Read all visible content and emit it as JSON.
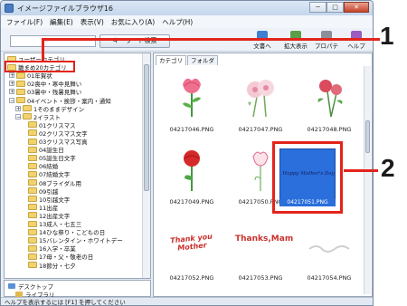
{
  "window": {
    "title": "イメージファイルブラウザ16",
    "buttons": {
      "minimize": "─",
      "maximize": "□",
      "close": "✕"
    }
  },
  "menu": [
    "ファイル(F)",
    "編集(E)",
    "表示(V)",
    "お気に入り(A)",
    "ヘルプ(H)"
  ],
  "toolbar": {
    "search_value": "",
    "search_button": "キーワード検索",
    "tools": [
      {
        "label": "文書へ",
        "icon": "document-icon"
      },
      {
        "label": "拡大表示",
        "icon": "zoom-icon"
      },
      {
        "label": "プロパティ",
        "icon": "properties-icon"
      },
      {
        "label": "ヘルプ",
        "icon": "help-icon"
      }
    ]
  },
  "tree": {
    "items": [
      {
        "label": "ユーザーカテゴリ",
        "depth": 0,
        "expander": ""
      },
      {
        "label": "雛まめ20カテゴリ",
        "depth": 0,
        "expander": ""
      },
      {
        "label": "01年賀状",
        "depth": 1,
        "expander": "+"
      },
      {
        "label": "02喪中・寒中見舞い",
        "depth": 1,
        "expander": "+"
      },
      {
        "label": "03暑中・残暑見舞い",
        "depth": 1,
        "expander": "+"
      },
      {
        "label": "04イベント・挨拶・案内・通知",
        "depth": 1,
        "expander": "−"
      },
      {
        "label": "1そのままデザイン",
        "depth": 2,
        "expander": "+"
      },
      {
        "label": "2イラスト",
        "depth": 2,
        "expander": "−"
      },
      {
        "label": "01クリスマス",
        "depth": 3,
        "expander": ""
      },
      {
        "label": "02クリスマス文字",
        "depth": 3,
        "expander": ""
      },
      {
        "label": "03クリスマス写真",
        "depth": 3,
        "expander": ""
      },
      {
        "label": "04誕生日",
        "depth": 3,
        "expander": ""
      },
      {
        "label": "05誕生日文字",
        "depth": 3,
        "expander": ""
      },
      {
        "label": "06結婚",
        "depth": 3,
        "expander": ""
      },
      {
        "label": "07結婚文字",
        "depth": 3,
        "expander": ""
      },
      {
        "label": "08ブライダル用",
        "depth": 3,
        "expander": ""
      },
      {
        "label": "09引越",
        "depth": 3,
        "expander": ""
      },
      {
        "label": "10引越文字",
        "depth": 3,
        "expander": ""
      },
      {
        "label": "11出産",
        "depth": 3,
        "expander": ""
      },
      {
        "label": "12出産文字",
        "depth": 3,
        "expander": ""
      },
      {
        "label": "13成人・七五三",
        "depth": 3,
        "expander": ""
      },
      {
        "label": "14ひな祭り・こどもの日",
        "depth": 3,
        "expander": ""
      },
      {
        "label": "15バレンタイン・ホワイトデー",
        "depth": 3,
        "expander": ""
      },
      {
        "label": "16入学・卒業",
        "depth": 3,
        "expander": ""
      },
      {
        "label": "17母・父・敬老の日",
        "depth": 3,
        "expander": ""
      },
      {
        "label": "18節分・七夕",
        "depth": 3,
        "expander": ""
      }
    ],
    "desktop_items": [
      {
        "label": "デスクトップ"
      },
      {
        "label": "ライブラリ"
      }
    ]
  },
  "tabs": [
    "カテゴリ",
    "フォルダ"
  ],
  "thumbnails": [
    {
      "name": "04217046.PNG",
      "art": "carnation-pink"
    },
    {
      "name": "04217047.PNG",
      "art": "flower-pair"
    },
    {
      "name": "04217048.PNG",
      "art": "carnation-bouquet"
    },
    {
      "name": "04217049.PNG",
      "art": "carnation-red"
    },
    {
      "name": "04217050.PNG",
      "art": "carnation-outline"
    },
    {
      "name": "04217051.PNG",
      "art": "mothers-day-card",
      "selected": true,
      "card_text": "Happy Mother's Day"
    },
    {
      "name": "04217052.PNG",
      "art": "text",
      "art_text": "Thank you Mother"
    },
    {
      "name": "04217053.PNG",
      "art": "text",
      "art_text": "Thanks,Mam"
    },
    {
      "name": "04217054.PNG",
      "art": "faint-text"
    }
  ],
  "status": "ヘルプを表示するには [F1] を押してください",
  "callouts": [
    "1",
    "2"
  ],
  "colors": {
    "callout": "#e3241b",
    "selection": "#2a6fdc"
  }
}
